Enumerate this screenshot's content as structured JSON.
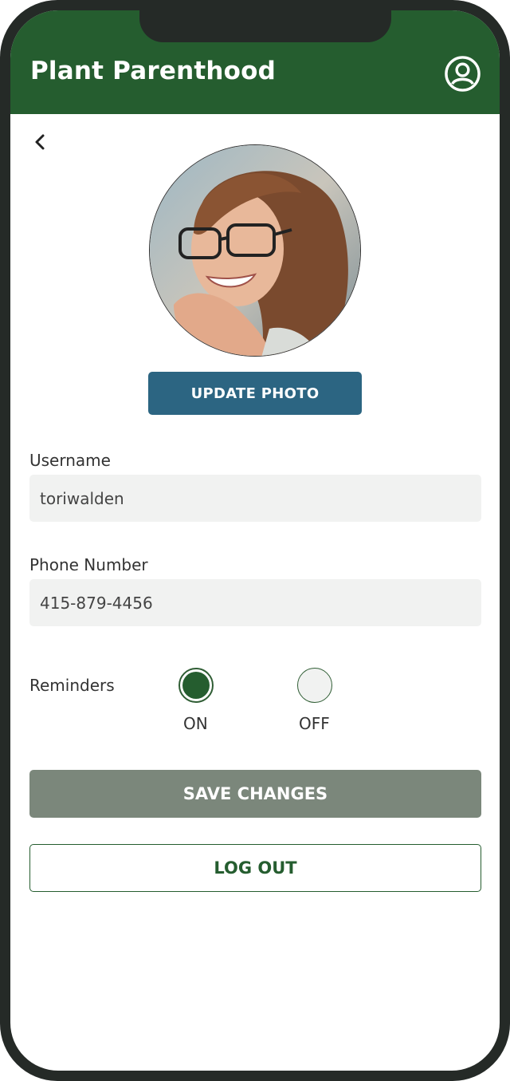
{
  "header": {
    "title": "Plant Parenthood",
    "profile_icon": "user-circle-icon"
  },
  "nav": {
    "back_icon": "chevron-left-icon"
  },
  "profile": {
    "photo": "profile-photo",
    "update_photo_label": "UPDATE PHOTO"
  },
  "form": {
    "username": {
      "label": "Username",
      "value": "toriwalden"
    },
    "phone": {
      "label": "Phone Number",
      "value": "415-879-4456"
    },
    "reminders": {
      "label": "Reminders",
      "options": [
        {
          "label": "ON",
          "selected": true
        },
        {
          "label": "OFF",
          "selected": false
        }
      ]
    }
  },
  "actions": {
    "save_label": "SAVE CHANGES",
    "logout_label": "LOG OUT"
  },
  "colors": {
    "brand_green": "#255d2f",
    "update_blue": "#2c6582",
    "save_gray": "#7b877b",
    "field_bg": "#f1f2f1"
  }
}
